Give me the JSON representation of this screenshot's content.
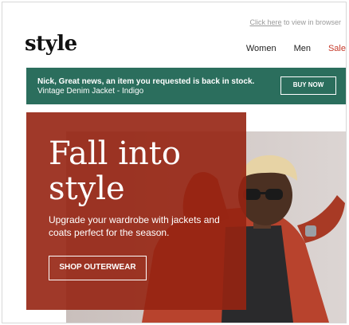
{
  "header": {
    "view_in_browser_link": "Click here",
    "view_in_browser_text": " to view in browser",
    "logo": "style",
    "nav": [
      {
        "label": "Women"
      },
      {
        "label": "Men"
      },
      {
        "label": "Sale"
      }
    ]
  },
  "notification": {
    "line1": "Nick, Great news, an item you requested is back in stock.",
    "line2": "Vintage Denim Jacket - Indigo",
    "cta": "BUY NOW"
  },
  "hero": {
    "headline_line1": "Fall into",
    "headline_line2": "style",
    "subcopy": "Upgrade your wardrobe with jackets and coats perfect for the season.",
    "cta": "SHOP OUTERWEAR"
  },
  "colors": {
    "banner": "#2b6e5d",
    "hero_panel": "#9a2a17",
    "sale": "#c63a2a"
  }
}
